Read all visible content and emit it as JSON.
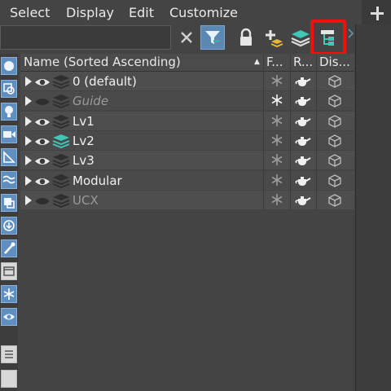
{
  "menu": {
    "items": [
      "Select",
      "Display",
      "Edit",
      "Customize"
    ]
  },
  "toolbar": {
    "search_value": "",
    "buttons": [
      "close-icon",
      "filter-icon",
      "lock-icon",
      "add-to-layer-icon",
      "layers-icon",
      "hierarchy-icon"
    ],
    "highlighted": "hierarchy-icon"
  },
  "left_tools": [
    "geometry-icon",
    "shapes-icon",
    "lights-icon",
    "cameras-icon",
    "helpers-icon",
    "space-warps-icon",
    "groups-icon",
    "xrefs-icon",
    "bones-icon",
    "containers-icon",
    "frozen-icon",
    "hidden-icon",
    "list-icon",
    "square-icon"
  ],
  "table": {
    "headers": {
      "name": "Name (Sorted Ascending)",
      "freeze": "F...",
      "render": "R...",
      "display": "Dis..."
    },
    "rows": [
      {
        "name": "0 (default)",
        "visible": true,
        "active": false,
        "style": "normal"
      },
      {
        "name": "Guide",
        "visible": false,
        "active": false,
        "style": "dim"
      },
      {
        "name": "Lv1",
        "visible": true,
        "active": false,
        "style": "normal"
      },
      {
        "name": "Lv2",
        "visible": true,
        "active": true,
        "style": "normal"
      },
      {
        "name": "Lv3",
        "visible": true,
        "active": false,
        "style": "normal"
      },
      {
        "name": "Modular",
        "visible": true,
        "active": false,
        "style": "normal"
      },
      {
        "name": "UCX",
        "visible": false,
        "active": false,
        "style": "muted"
      }
    ]
  },
  "colors": {
    "accent": "#5b87b3",
    "active_layer": "#3fc8b8",
    "highlight_border": "#ee1111"
  }
}
